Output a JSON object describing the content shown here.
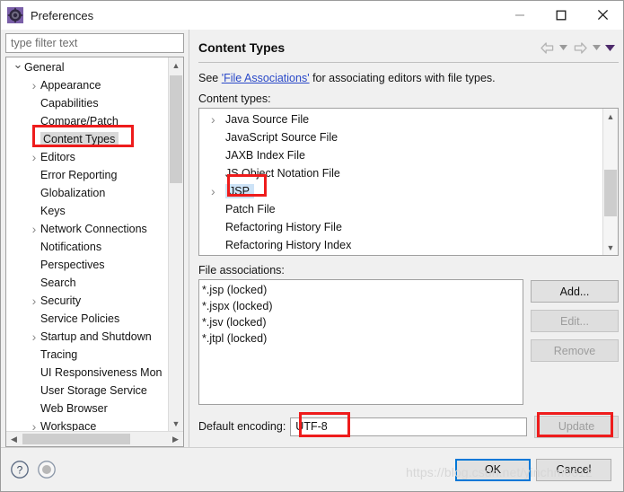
{
  "window": {
    "title": "Preferences",
    "icon": "preferences-gear-icon",
    "controls": {
      "minimize": "minimize-icon",
      "maximize": "maximize-icon",
      "close": "close-icon"
    }
  },
  "sidebar": {
    "filter": {
      "placeholder": "type filter text",
      "value": ""
    },
    "items": [
      {
        "label": "General",
        "indent": 0,
        "twisty": "expanded",
        "selected": false
      },
      {
        "label": "Appearance",
        "indent": 1,
        "twisty": "collapsed",
        "selected": false
      },
      {
        "label": "Capabilities",
        "indent": 1,
        "twisty": "none",
        "selected": false
      },
      {
        "label": "Compare/Patch",
        "indent": 1,
        "twisty": "none",
        "selected": false
      },
      {
        "label": "Content Types",
        "indent": 1,
        "twisty": "none",
        "selected": true
      },
      {
        "label": "Editors",
        "indent": 1,
        "twisty": "collapsed",
        "selected": false
      },
      {
        "label": "Error Reporting",
        "indent": 1,
        "twisty": "none",
        "selected": false
      },
      {
        "label": "Globalization",
        "indent": 1,
        "twisty": "none",
        "selected": false
      },
      {
        "label": "Keys",
        "indent": 1,
        "twisty": "none",
        "selected": false
      },
      {
        "label": "Network Connections",
        "indent": 1,
        "twisty": "collapsed",
        "selected": false
      },
      {
        "label": "Notifications",
        "indent": 1,
        "twisty": "none",
        "selected": false
      },
      {
        "label": "Perspectives",
        "indent": 1,
        "twisty": "none",
        "selected": false
      },
      {
        "label": "Search",
        "indent": 1,
        "twisty": "none",
        "selected": false
      },
      {
        "label": "Security",
        "indent": 1,
        "twisty": "collapsed",
        "selected": false
      },
      {
        "label": "Service Policies",
        "indent": 1,
        "twisty": "none",
        "selected": false
      },
      {
        "label": "Startup and Shutdown",
        "indent": 1,
        "twisty": "collapsed",
        "selected": false
      },
      {
        "label": "Tracing",
        "indent": 1,
        "twisty": "none",
        "selected": false
      },
      {
        "label": "UI Responsiveness Mon",
        "indent": 1,
        "twisty": "none",
        "selected": false
      },
      {
        "label": "User Storage Service",
        "indent": 1,
        "twisty": "none",
        "selected": false
      },
      {
        "label": "Web Browser",
        "indent": 1,
        "twisty": "none",
        "selected": false
      },
      {
        "label": "Workspace",
        "indent": 1,
        "twisty": "collapsed",
        "selected": false
      }
    ]
  },
  "page": {
    "title": "Content Types",
    "nav": {
      "back": "back-arrow-icon",
      "back_menu": "caret-down-icon",
      "forward": "forward-arrow-icon",
      "forward_menu": "caret-down-icon",
      "view_menu": "caret-down-icon"
    },
    "description": {
      "prefix": "See ",
      "link": "'File Associations'",
      "suffix": " for associating editors with file types."
    },
    "content_types_label": "Content types:",
    "content_types": [
      {
        "label": "Java Source File",
        "twisty": "collapsed",
        "selected": false
      },
      {
        "label": "JavaScript Source File",
        "twisty": "none",
        "selected": false
      },
      {
        "label": "JAXB Index File",
        "twisty": "none",
        "selected": false
      },
      {
        "label": "JS Object Notation File",
        "twisty": "none",
        "selected": false
      },
      {
        "label": "JSP",
        "twisty": "collapsed",
        "selected": true
      },
      {
        "label": "Patch File",
        "twisty": "none",
        "selected": false
      },
      {
        "label": "Refactoring History File",
        "twisty": "none",
        "selected": false
      },
      {
        "label": "Refactoring History Index",
        "twisty": "none",
        "selected": false
      }
    ],
    "file_associations_label": "File associations:",
    "file_associations": [
      "*.jsp (locked)",
      "*.jspx (locked)",
      "*.jsv (locked)",
      "*.jtpl (locked)"
    ],
    "assoc_buttons": [
      {
        "label": "Add...",
        "enabled": true,
        "name": "add-button"
      },
      {
        "label": "Edit...",
        "enabled": false,
        "name": "edit-button"
      },
      {
        "label": "Remove",
        "enabled": false,
        "name": "remove-button"
      }
    ],
    "encoding": {
      "label": "Default encoding:",
      "value": "UTF-8",
      "update_label": "Update",
      "update_enabled": false
    }
  },
  "footer": {
    "help_icon": "help-question-icon",
    "secondary_icon": "circle-button-icon",
    "ok_label": "OK",
    "cancel_label": "Cancel"
  },
  "watermark": "https://blog.csdn.net/yinchm0612",
  "colors": {
    "accent": "#0078d7",
    "annotation": "#ee1c1c",
    "link": "#2a49c8",
    "selection": "#cde3f7",
    "tree_selection": "#d9d9d9"
  }
}
